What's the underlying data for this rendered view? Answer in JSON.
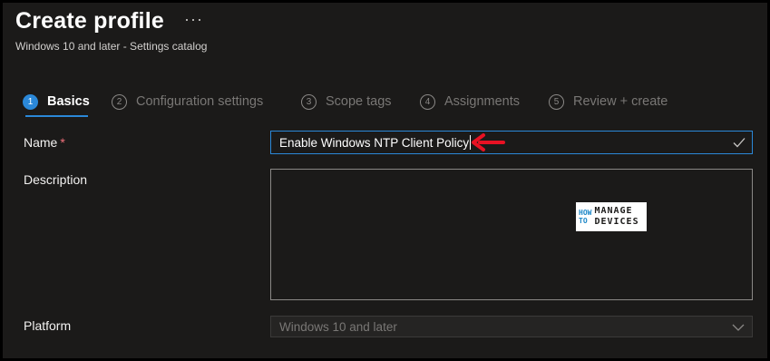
{
  "header": {
    "title": "Create profile",
    "more_label": "···",
    "subtitle": "Windows 10 and later - Settings catalog"
  },
  "steps": [
    {
      "num": "1",
      "label": "Basics",
      "active": true
    },
    {
      "num": "2",
      "label": "Configuration settings",
      "active": false
    },
    {
      "num": "3",
      "label": "Scope tags",
      "active": false
    },
    {
      "num": "4",
      "label": "Assignments",
      "active": false
    },
    {
      "num": "5",
      "label": "Review + create",
      "active": false
    }
  ],
  "form": {
    "name_label": "Name",
    "name_required": "*",
    "name_value": "Enable Windows NTP Client Policy",
    "description_label": "Description",
    "description_value": "",
    "platform_label": "Platform",
    "platform_value": "Windows 10 and later"
  },
  "watermark": {
    "left_top": "HOW",
    "left_bottom": "TO",
    "right_top": "MANAGE",
    "right_bottom": "DEVICES"
  },
  "colors": {
    "background": "#1b1a19",
    "accent": "#2b88d8",
    "annotation_arrow": "#e81123",
    "required": "#f1707b"
  },
  "icons": {
    "name_valid": "check-icon",
    "platform_dropdown": "chevron-down-icon",
    "annotation": "arrow-left-icon"
  }
}
